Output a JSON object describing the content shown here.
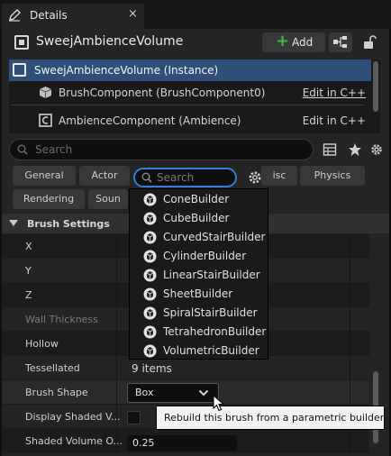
{
  "window": {
    "tab_title": "Details",
    "tab_close": "×"
  },
  "header": {
    "actor_name": "SweejAmbienceVolume",
    "add_label": "Add"
  },
  "components": [
    {
      "label": "SweejAmbienceVolume (Instance)",
      "link": ""
    },
    {
      "label": "BrushComponent (BrushComponent0)",
      "link": "Edit in C++"
    },
    {
      "label": "AmbienceComponent (Ambience)",
      "link": "Edit in C++"
    }
  ],
  "search": {
    "placeholder": "Search"
  },
  "categories": {
    "general": "General",
    "actor": "Actor",
    "misc": "isc",
    "physics": "Physics",
    "rendering": "Rendering",
    "sound": "Soun"
  },
  "popup": {
    "search_placeholder": "Search",
    "items": [
      "ConeBuilder",
      "CubeBuilder",
      "CurvedStairBuilder",
      "CylinderBuilder",
      "LinearStairBuilder",
      "SheetBuilder",
      "SpiralStairBuilder",
      "TetrahedronBuilder",
      "VolumetricBuilder"
    ]
  },
  "section": {
    "title": "Brush Settings"
  },
  "properties": {
    "x": "X",
    "y": "Y",
    "z": "Z",
    "wall_thickness": "Wall Thickness",
    "hollow": "Hollow",
    "tessellated": "Tessellated",
    "tessellated_value": "9 items",
    "brush_shape": "Brush Shape",
    "brush_shape_value": "Box",
    "display_shaded": "Display Shaded V...",
    "shaded_opacity": "Shaded Volume O...",
    "shaded_opacity_value": "0.25"
  },
  "tooltip": {
    "text": "Rebuild this brush from a parametric builder."
  },
  "colors": {
    "accent_blue": "#2f7fd8",
    "selection": "#2f4f79",
    "add_green": "#3fbc3f"
  }
}
